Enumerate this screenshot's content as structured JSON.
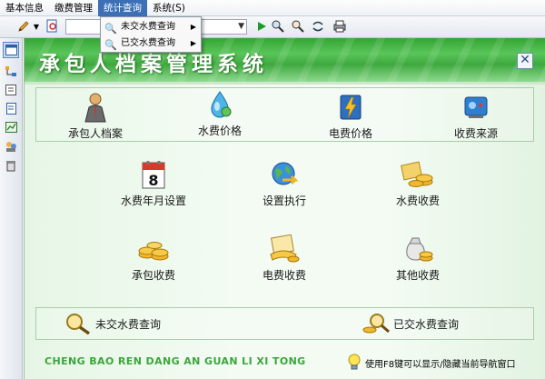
{
  "menubar": {
    "items": [
      {
        "label": "基本信息"
      },
      {
        "label": "缴费管理"
      },
      {
        "label": "统计查询"
      },
      {
        "label": "系统(S)"
      }
    ],
    "active_index": 2
  },
  "dropdown": {
    "items": [
      {
        "label": "未交水费查询",
        "icon": "search-doc-icon"
      },
      {
        "label": "已交水费查询",
        "icon": "search-doc-icon"
      }
    ]
  },
  "header": {
    "title": "承包人档案管理系统",
    "close_glyph": "✕"
  },
  "top_row": [
    {
      "label": "承包人档案",
      "icon": "person-icon"
    },
    {
      "label": "水费价格",
      "icon": "water-drop-icon"
    },
    {
      "label": "电费价格",
      "icon": "lightning-icon"
    },
    {
      "label": "收费来源",
      "icon": "device-icon"
    }
  ],
  "middle_row_1": [
    {
      "label": "水费年月设置",
      "icon": "calendar-icon"
    },
    {
      "label": "设置执行",
      "icon": "globe-execute-icon"
    },
    {
      "label": "水费收费",
      "icon": "coins-icon"
    }
  ],
  "calendar_day": "8",
  "middle_row_2": [
    {
      "label": "承包收费",
      "icon": "coins-icon"
    },
    {
      "label": "电费收费",
      "icon": "bill-icon"
    },
    {
      "label": "其他收费",
      "icon": "money-bag-icon"
    }
  ],
  "queries": [
    {
      "label": "未交水费查询",
      "icon": "magnifier-icon"
    },
    {
      "label": "已交水费查询",
      "icon": "magnifier-coin-icon"
    }
  ],
  "footer": {
    "pinyin": "CHENG BAO REN DANG AN GUAN LI XI TONG",
    "tip": "使用F8键可以显示/隐藏当前导航窗口"
  },
  "colors": {
    "header_green": "#3ea93e",
    "pinyin_green": "#3aa63a",
    "menu_active": "#3b6fb6"
  }
}
